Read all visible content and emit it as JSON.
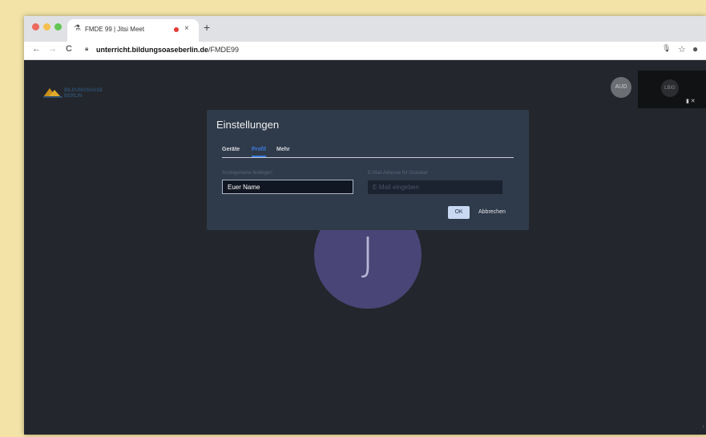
{
  "browser": {
    "tab": {
      "title": "FMDE 99 | Jitsi Meet",
      "close": "×"
    },
    "new_tab": "+",
    "nav": {
      "back": "←",
      "forward": "→",
      "reload": "C"
    },
    "url_domain": "unterricht.bildungsoaseberlin.de",
    "url_path": "/FMDE99"
  },
  "meeting": {
    "logo_text_line1": "BILDUNGSOASE",
    "logo_text_line2": "BERLIN",
    "participant_initial": "J",
    "small_avatar_initials": "AUD",
    "thumbnail_initials": "LBIG"
  },
  "dialog": {
    "title": "Einstellungen",
    "tabs": [
      {
        "label": "Geräte",
        "active": false
      },
      {
        "label": "Profil",
        "active": true
      },
      {
        "label": "Mehr",
        "active": false
      }
    ],
    "display_name_label": "Anzeigename festlegen",
    "display_name_value": "Euer Name",
    "email_label": "E-Mail-Adresse für Gravatar",
    "email_placeholder": "E-Mail eingeben",
    "ok_label": "OK",
    "cancel_label": "Abbrechen"
  },
  "colors": {
    "accent": "#3b7ddd",
    "dialog_bg": "#2f3a4a",
    "stage_bg": "#23262c",
    "avatar_bg": "#4a4577"
  }
}
